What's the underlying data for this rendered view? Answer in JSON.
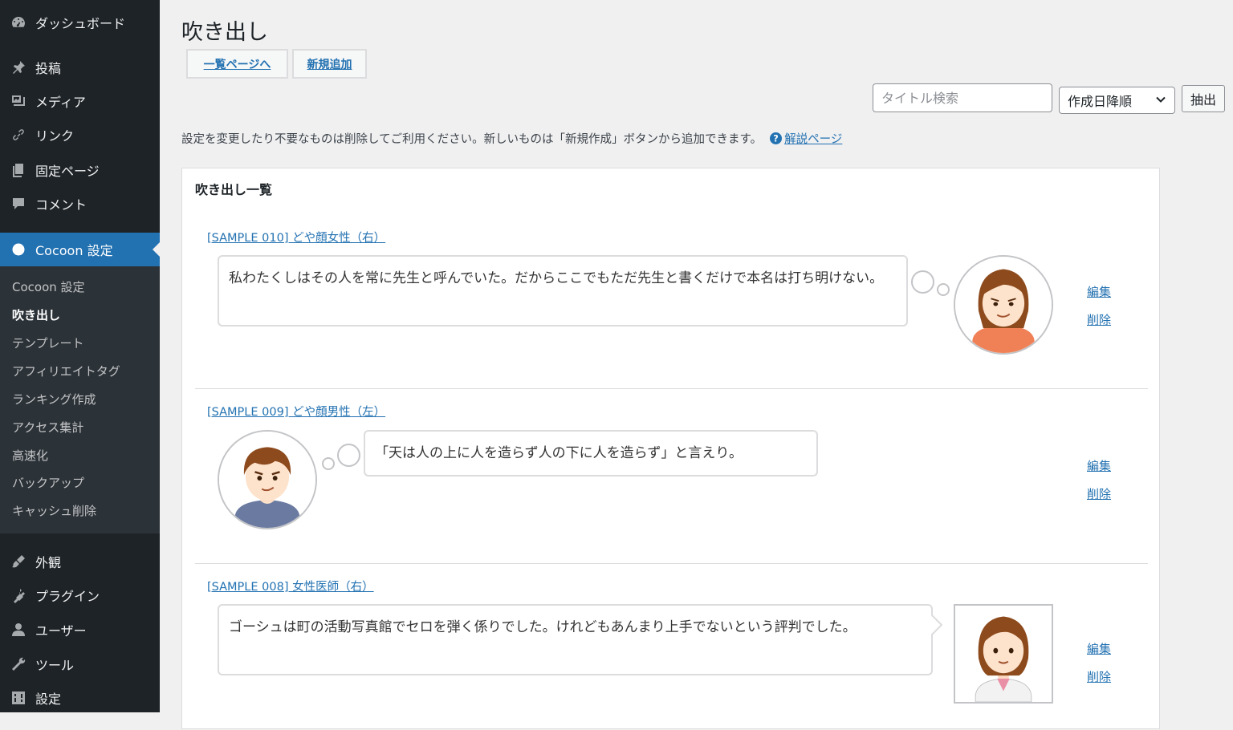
{
  "sidebar": {
    "top_items": [
      {
        "label": "ダッシュボード",
        "icon": "dashboard-icon"
      },
      {
        "label": "投稿",
        "icon": "pin-icon"
      },
      {
        "label": "メディア",
        "icon": "media-icon"
      },
      {
        "label": "リンク",
        "icon": "link-icon"
      },
      {
        "label": "固定ページ",
        "icon": "pages-icon"
      },
      {
        "label": "コメント",
        "icon": "comment-icon"
      }
    ],
    "active_item": {
      "label": "Cocoon 設定",
      "icon": "cocoon-icon"
    },
    "sub_items": [
      "Cocoon 設定",
      "吹き出し",
      "テンプレート",
      "アフィリエイトタグ",
      "ランキング作成",
      "アクセス集計",
      "高速化",
      "バックアップ",
      "キャッシュ削除"
    ],
    "current_sub": "吹き出し",
    "bottom_items": [
      {
        "label": "外観",
        "icon": "appearance-icon"
      },
      {
        "label": "プラグイン",
        "icon": "plugin-icon"
      },
      {
        "label": "ユーザー",
        "icon": "user-icon"
      },
      {
        "label": "ツール",
        "icon": "tool-icon"
      },
      {
        "label": "設定",
        "icon": "settings-icon"
      }
    ]
  },
  "main": {
    "title": "吹き出し",
    "buttons": {
      "list_page": "一覧ページへ",
      "add_new": "新規追加"
    },
    "search": {
      "placeholder": "タイトル検索",
      "value": ""
    },
    "sort": {
      "selected": "作成日降順"
    },
    "filter_label": "抽出",
    "notice": "設定を変更したり不要なものは削除してご利用ください。新しいものは「新規作成」ボタンから追加できます。",
    "help_link": "解説ページ",
    "panel_title": "吹き出し一覧",
    "entries": [
      {
        "title": "[SAMPLE 010] どや顔女性（右）",
        "text": "私わたくしはその人を常に先生と呼んでいた。だからここでもただ先生と書くだけで本名は打ち明けない。",
        "side": "right",
        "style": "think",
        "avatar": "smug-woman-avatar",
        "edit": "編集",
        "delete": "削除"
      },
      {
        "title": "[SAMPLE 009] どや顔男性（左）",
        "text": "「天は人の上に人を造らず人の下に人を造らず」と言えり。",
        "side": "left",
        "style": "think",
        "avatar": "smug-man-avatar",
        "edit": "編集",
        "delete": "削除"
      },
      {
        "title": "[SAMPLE 008] 女性医師（右）",
        "text": "ゴーシュは町の活動写真館でセロを弾く係りでした。けれどもあんまり上手でないという評判でした。",
        "side": "right",
        "style": "speech",
        "avatar": "female-doctor-avatar",
        "edit": "編集",
        "delete": "削除"
      }
    ]
  },
  "colors": {
    "sidebar_bg": "#1d2327",
    "submenu_bg": "#2c3338",
    "accent": "#2271b1",
    "page_bg": "#f0f0f1"
  }
}
